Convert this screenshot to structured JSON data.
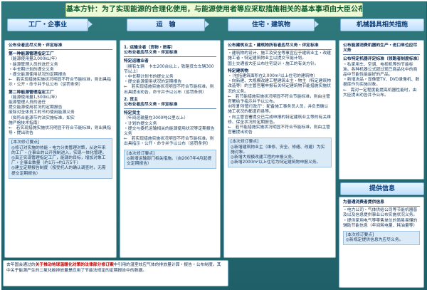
{
  "banner": {
    "text": "基本方针：为了实现能源的合理化使用，与能源使用者等应采取措施相关的基本事项由大臣公布"
  },
  "categories": [
    {
      "title": "工厂・企事业"
    },
    {
      "title": "运　输"
    },
    {
      "title": "住宅・建筑物"
    },
    {
      "title": "机械器具相关措施"
    }
  ],
  "factory": {
    "title": "公布业者应尽义务・评定标准",
    "first_title": "第一种能源管理指定工厂",
    "first_sub": "（能源使用量3,000kL/年）",
    "first_items": "・能源管理人员的选任义务\n・中长期计划的提交义务\n・提交能源使用状况的定期报告\n←　若实现措施实施状况明显不符合节能标准，则出具指示・公开・命令并予以公布（惩罚条例）",
    "second_title": "第二种能源管理指定工厂",
    "second_sub": "（能源使用量1,500kL/年）",
    "second_items": "能源管理人员的选任\n提交能源使用状况的定期报告\n废除对全体员工的节约使用能源义务\n（拟符合能源节约法实施标准，如实\n施严格技术指南）\n←　若实现措施实施状况明显不符合节能标准，则出具指导・提出劝告",
    "note": "[本次修订要点]\n◎修订对实施的热能・电力分类管理对策，从这年来的工厂・企事业的公开强制进入，实现一体化管理。\n◎真正实现管理指定工厂，能源的目标，增加对象工厂・企事业数量（约1万→约1万5千）\n◎建立定期报告制度（按受托人的确认调查时，无需提交定期报告）"
  },
  "transport": {
    "title1": "1. 运输业者（货物・旅客）",
    "sec1": "公布业者应尽义务・评定标准",
    "spec1_title": "特定运输业者",
    "spec1_items": "（拥有车辆　卡车200台以上，铁路货车车辆300节以上）\n・中长期计划书的提交义务\n・提交能源使用状况的定期报告\n←　若实现措施实施状况明显不符合节能标准，则出具提出劝告，命令并予以公布（惩罚条例）",
    "title2": "2. 货主",
    "sec2": "公布业者应尽义务・评定标准",
    "spec2_title": "特定货主",
    "spec2_items": "（年间运输量在3000吨公里以上）\n・计划的提交义务\n・提交与委托运输相关的能源使用状况等定期报告义务\n←　若实现措施实施状况明显不符合节能标准，则出具指示・公开・命令并予以公布（惩罚条例）",
    "note": "[本次修订要点]\n◎新增运输部门相关措施。（自2007年4月起提交定期报告）"
  },
  "housing": {
    "title": "公布建筑业主・建筑物所有者应尽义务・评定标准",
    "body1": "・建筑物的设计、施工及安全等事宜应于建筑业主・改建施工者・特定建筑物业主以提交节能计划。\n国土交通省大臣公布住宅设计・施工的有关方针。",
    "spec_title": "特定建筑物",
    "body2": "・（包括建筑面积在2,000m²以上住宅的建筑物）\n・向新建、大规模改建工程建筑业主・物主（特定建筑物改造等）的主管官署申报有关特定建筑物节能措施实施状况的义务。\n←　若节能措施实施状况明显不符合节能标准，则由主管官署给予指示并予以公布。\n※所谓'所管行政厅'：配备施工事务员人员，并负责确认施工状况的都道府县等。\n・向主管官署提交已完成申报的特定建筑业主等的有关维修、保全状况的定期报告。\n←　若节能措施实施状况明显不符合节能标准，则由主管官署提出劝告",
    "note": "[本次修订要点]\n◎新增建筑物业主（维修、安全、修缮、改建）为实施对象。\n◎新增大规模改建工程的申报义务。\n◎新增2000m²以上住宅为特定建筑物申报义务。"
  },
  "machinery": {
    "title": "公布能源消费机器的生产・进口单位应尽义务",
    "sub": "公布特定机器评定标准（领跑者制度标准）",
    "items": "・私家用车、空调、电视机等的节能标准。各种机器公式超过现已商品化中的商品中节能性能最好的产品。\n・新增决品・显像管TV、DVD录像机、数据库作为实施对象。\n←　需对一定程度能提高机器性能时，由大臣提出劝告并予公布。"
  },
  "provide": {
    "header": "提供信息",
    "title": "为普通消费者提供信息",
    "body": "・电力公司・气体供给公司等节能机器普及以及信息提供事业公布实施状况义务。\n・提供家用电气等零售单位的简易易懂的辅助节能信息（年间耗电量、耗油量等）",
    "note": "[本次修订要点]\n◎新规定提供信息为应尽义务。"
  },
  "bottom": {
    "prefix": "去年国会通过的",
    "highlight": "关于推动地球温暖化对策的法律部分修订案",
    "suffix": "中引用的温室效应气体的排放量计算・报告・公布制度。其中关于能源产生的二氧化碳排放量是应用了节能法规定的定期报告中的数据。"
  }
}
